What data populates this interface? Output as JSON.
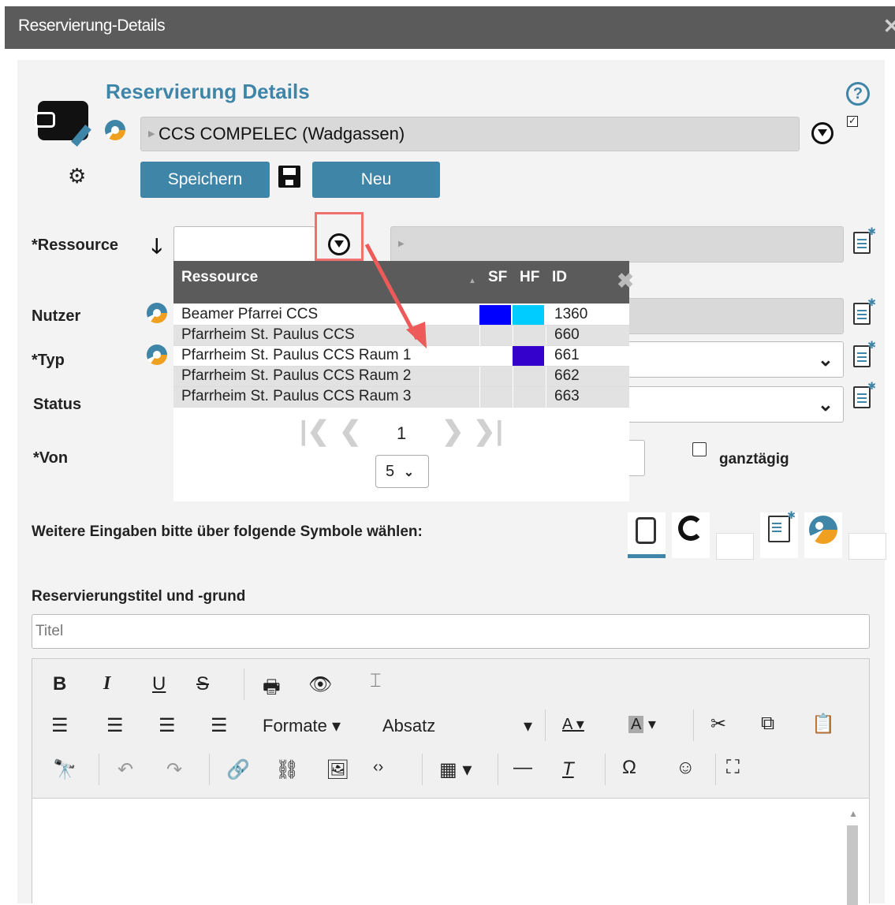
{
  "window": {
    "title": "Reservierung-Details",
    "close_icon": "close-icon"
  },
  "header": {
    "title": "Reservierung Details",
    "organization": "CCS COMPELEC (Wadgassen)",
    "save_label": "Speichern",
    "new_label": "Neu",
    "org_checked": true
  },
  "form": {
    "resource_label": "*Ressource",
    "resource_value": "",
    "user_label": "Nutzer",
    "type_label": "*Typ",
    "status_label": "Status",
    "from_label": "*Von",
    "allday_label": "ganztägig",
    "allday_checked": false
  },
  "dropdown": {
    "columns": [
      "Ressource",
      "SF",
      "HF",
      "ID"
    ],
    "rows": [
      {
        "name": "Beamer Pfarrei CCS",
        "sf": "#0000ff",
        "hf": "#00ccff",
        "id": "1360"
      },
      {
        "name": "Pfarrheim St. Paulus CCS",
        "sf": "",
        "hf": "",
        "id": "660"
      },
      {
        "name": "Pfarrheim St. Paulus CCS Raum 1",
        "sf": "",
        "hf": "#3300cc",
        "id": "661"
      },
      {
        "name": "Pfarrheim St. Paulus CCS Raum 2",
        "sf": "",
        "hf": "",
        "id": "662"
      },
      {
        "name": "Pfarrheim St. Paulus CCS Raum 3",
        "sf": "",
        "hf": "",
        "id": "663"
      }
    ],
    "page": "1",
    "page_size": "5"
  },
  "more_inputs": {
    "prompt": "Weitere Eingaben bitte über folgende Symbole wählen:"
  },
  "reservation": {
    "section_label": "Reservierungstitel und -grund",
    "title_placeholder": "Titel"
  },
  "editor": {
    "formats_label": "Formate",
    "paragraph_label": "Absatz"
  },
  "colors": {
    "accent": "#3f85a8",
    "titlebar": "#5b5b5b",
    "highlight_box": "#f07070"
  }
}
